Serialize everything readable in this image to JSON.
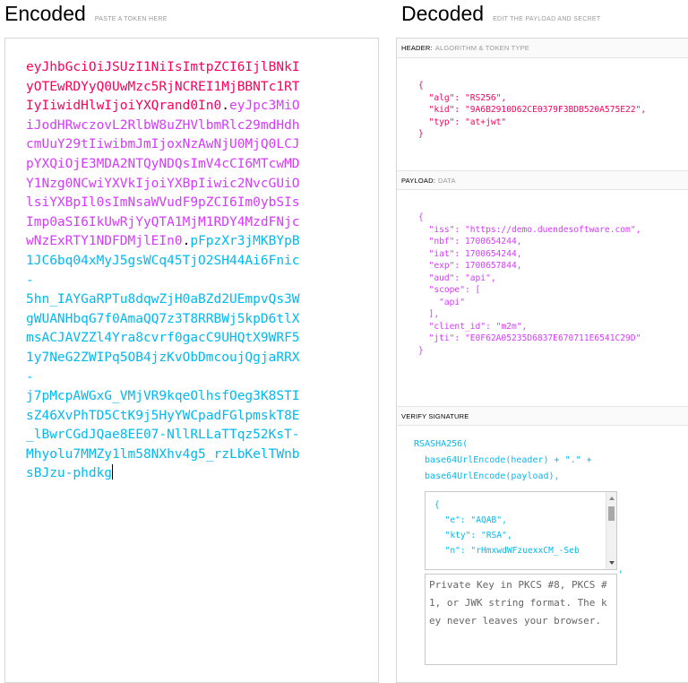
{
  "encoded": {
    "title": "Encoded",
    "hint": "PASTE A TOKEN HERE",
    "header_lines": [
      "eyJhbGciOiJSUzI1NiIsImtpZCI6IjlBNkI",
      "yOTEwRDYyQ0UwMzc5RjNCREI1MjBBNTc1RT",
      "IyIiwidHlwIjoiYXQrand0In0"
    ],
    "payload_lines": [
      "eyJpc3MiO",
      "iJodHRwczovL2RlbW8uZHVlbmRlc29mdHdh",
      "cmUuY29tIiwibmJmIjoxNzAwNjU0MjQ0LCJ",
      "pYXQiOjE3MDA2NTQyNDQsImV4cCI6MTcwMD",
      "Y1Nzg0NCwiYXVkIjoiYXBpIiwic2NvcGUiO",
      "lsiYXBpIl0sImNsaWVudF9pZCI6Im0ybSIs",
      "Imp0aSI6IkUwRjYyQTA1MjM1RDY4MzdFNjc",
      "wNzExRTY1NDFDMjlEIn0"
    ],
    "signature_lines": [
      "pFpzXr3jMKBYpB",
      "1JC6bq04xMyJ5gsWCq45TjO2SH44Ai6Fnic",
      "-",
      "5hn_IAYGaRPTu8dqwZjH0aBZd2UEmpvQs3W",
      "gWUANHbqG7f0AmaQQ7z3T8RRBWj5kpD6tlX",
      "msACJAVZZl4Yra8cvrf0gacC9UHQtX9WRF5",
      "1y7NeG2ZWIPq5OB4jzKvObDmcoujQgjaRRX",
      "-",
      "j7pMcpAWGxG_VMjVR9kqeOlhsfOeg3K8STI",
      "sZ46XvPhTD5CtK9j5HyYWCpadFGlpmskT8E",
      "_lBwrCGdJQae8EE07-NllRLLaTTqz52KsT-",
      "Mhyolu7MMZy1lm58NXhv4g5_rzLbKelTWnb",
      "sBJzu-phdkg"
    ]
  },
  "decoded": {
    "title": "Decoded",
    "hint": "EDIT THE PAYLOAD AND SECRET",
    "header_section": {
      "label": "HEADER:",
      "sub": "ALGORITHM & TOKEN TYPE"
    },
    "header_json": "{\n  \"alg\": \"RS256\",\n  \"kid\": \"9A6B2910D62CE0379F3BDB520A575E22\",\n  \"typ\": \"at+jwt\"\n}",
    "payload_section": {
      "label": "PAYLOAD:",
      "sub": "DATA"
    },
    "payload_json": "{\n  \"iss\": \"https://demo.duendesoftware.com\",\n  \"nbf\": 1700654244,\n  \"iat\": 1700654244,\n  \"exp\": 1700657844,\n  \"aud\": \"api\",\n  \"scope\": [\n    \"api\"\n  ],\n  \"client_id\": \"m2m\",\n  \"jti\": \"E0F62A05235D6837E670711E6541C29D\"\n}",
    "verify_section": {
      "label": "VERIFY SIGNATURE"
    },
    "verify_code": "RSASHA256(\n  base64UrlEncode(header) + \".\" +\n  base64UrlEncode(payload),",
    "public_key_json": "{\n  \"e\": \"AQAB\",\n  \"kty\": \"RSA\",\n  \"n\": \"rHmxwdWFzuexxCM_-Seb",
    "comma": ",",
    "private_key_placeholder": "Private Key in PKCS #8, PKCS #1, or JWK string format. The key never leaves your browser."
  },
  "colors": {
    "header": "#fb015b",
    "payload": "#d63aff",
    "signature": "#00b9f1"
  }
}
